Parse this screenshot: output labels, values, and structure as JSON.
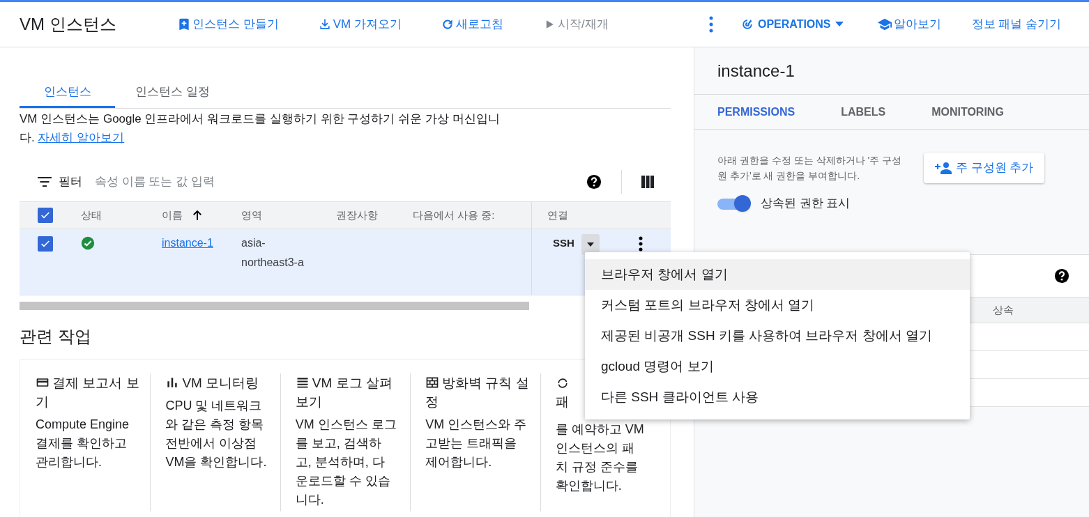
{
  "header": {
    "title": "VM 인스턴스",
    "actions": [
      {
        "kind": "create",
        "label": "인스턴스 만들기",
        "disabled": false
      },
      {
        "kind": "import",
        "label": "VM 가져오기",
        "disabled": false
      },
      {
        "kind": "refresh",
        "label": "새로고침",
        "disabled": false
      },
      {
        "kind": "start",
        "label": "시작/재개",
        "disabled": true
      }
    ],
    "operations": "OPERATIONS",
    "learn": "알아보기",
    "hide_panel": "정보 패널 숨기기"
  },
  "tabs": [
    {
      "label": "인스턴스",
      "selected": true
    },
    {
      "label": "인스턴스 일정",
      "selected": false
    }
  ],
  "description": "VM 인스턴스는 Google 인프라에서 워크로드를 실행하기 위한 구성하기 쉬운 가상 머신입니다.",
  "learn_more": "자세히 알아보기",
  "filter": {
    "label": "필터",
    "placeholder": "속성 이름 또는 값 입력"
  },
  "table": {
    "all_checked": true,
    "columns": [
      "상태",
      "이름",
      "영역",
      "권장사항",
      "다음에서 사용 중:",
      "연결"
    ],
    "rows": [
      {
        "checked": true,
        "running": true,
        "name": "instance-1",
        "zone": "asia-northeast3-a",
        "connect": "SSH"
      }
    ]
  },
  "ssh_menu": [
    {
      "label": "브라우저 창에서 열기",
      "selected": true
    },
    {
      "label": "커스텀 포트의 브라우저 창에서 열기",
      "selected": false
    },
    {
      "label": "제공된 비공개 SSH 키를 사용하여 브라우저 창에서 열기",
      "selected": false
    },
    {
      "label": "gcloud 명령어 보기",
      "selected": false
    },
    {
      "label": "다른 SSH 클라이언트 사용",
      "selected": false
    }
  ],
  "related": {
    "title": "관련 작업",
    "cards": [
      {
        "kind": "billing",
        "title": "결제 보고서 보기",
        "text": "Compute Engine 결제를 확인하고 관리합니다."
      },
      {
        "kind": "monitoring",
        "title": "VM 모니터링",
        "text": "CPU 및 네트워크와 같은 측정 항목 전반에서 이상점 VM을 확인합니다."
      },
      {
        "kind": "logs",
        "title": "VM 로그 살펴보기",
        "text": "VM 인스턴스 로그를 보고, 검색하고, 분석하며, 다운로드할 수 있습니다."
      },
      {
        "kind": "firewall",
        "title": "방화벽 규칙 설정",
        "text": "VM 인스턴스와 주고받는 트래픽을 제어합니다."
      },
      {
        "kind": "patch",
        "title": "패",
        "lines": [
          "를 예약하고 VM",
          "인스턴스의 패",
          "치 규정 준수를",
          "확인합니다."
        ]
      }
    ]
  },
  "panel": {
    "title": "instance-1",
    "tabs": [
      {
        "label": "PERMISSIONS",
        "selected": true
      },
      {
        "label": "LABELS",
        "selected": false
      },
      {
        "label": "MONITORING",
        "selected": false
      }
    ],
    "hint": "아래 권한을 수정 또는 삭제하거나 '주 구성원 추가'로 새 권한을 부여합니다.",
    "add_button": "주 구성원 추가",
    "toggle": {
      "label": "상속된 권한 표시",
      "on": true
    },
    "table_column": "상속"
  }
}
